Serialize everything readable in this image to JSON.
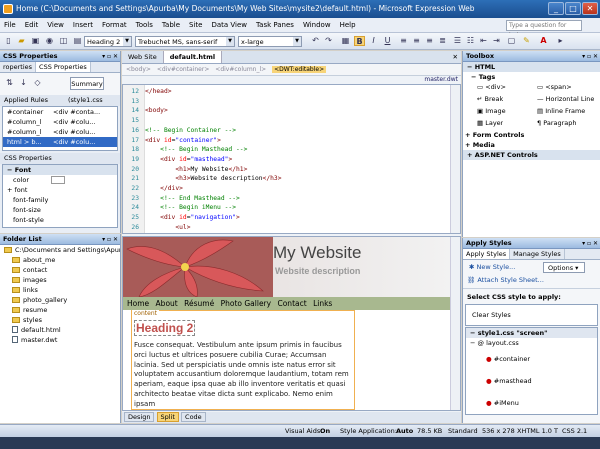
{
  "window": {
    "title": "Home (C:\\Documents and Settings\\Apurba\\My Documents\\My Web Sites\\mysite2\\default.html) - Microsoft Expression Web",
    "min": "_",
    "max": "□",
    "close": "✕"
  },
  "menu": [
    "File",
    "Edit",
    "View",
    "Insert",
    "Format",
    "Tools",
    "Table",
    "Site",
    "Data View",
    "Task Panes",
    "Window",
    "Help"
  ],
  "help_search": {
    "placeholder": "Type a question for help"
  },
  "toolbar": {
    "style": "Heading 2",
    "font": "Trebuchet MS, sans-serif",
    "size": "x-large",
    "bold": "B",
    "italic": "I",
    "underline": "U"
  },
  "css_properties_panel": {
    "title": "CSS Properties",
    "tabs": [
      "roperties",
      "CSS Properties"
    ],
    "summary_button": "Summary",
    "applied_rules_label": "Applied Rules",
    "applied_rules_source": "(style1.css",
    "rules": [
      [
        "#container",
        "<div #conta..."
      ],
      [
        "#column_l",
        "<div #colu..."
      ],
      [
        "#column_l",
        "<div #colu..."
      ],
      [
        "html > b...",
        "<div #colu..."
      ]
    ],
    "props_header": "CSS Properties",
    "font_group": "Font",
    "props": [
      "color",
      "font",
      "font-family",
      "font-size",
      "font-style"
    ]
  },
  "folder_list": {
    "title": "Folder List",
    "root": "C:\\Documents and Settings\\Apurba",
    "items": [
      {
        "name": "about_me",
        "type": "folder"
      },
      {
        "name": "contact",
        "type": "folder"
      },
      {
        "name": "images",
        "type": "folder"
      },
      {
        "name": "links",
        "type": "folder"
      },
      {
        "name": "photo_gallery",
        "type": "folder"
      },
      {
        "name": "resume",
        "type": "folder"
      },
      {
        "name": "styles",
        "type": "folder"
      },
      {
        "name": "default.html",
        "type": "file"
      },
      {
        "name": "master.dwt",
        "type": "file"
      }
    ]
  },
  "editor": {
    "tabs": [
      "Web Site",
      "default.html"
    ],
    "breadcrumb": [
      "<body>",
      "<div#container>",
      "<div#column_l>",
      "<DWT:editable>"
    ],
    "master_link": "master.dwt",
    "code_lines": [
      {
        "n": "12",
        "text": "</head>"
      },
      {
        "n": "13",
        "text": ""
      },
      {
        "n": "14",
        "text": "<body>"
      },
      {
        "n": "15",
        "text": ""
      },
      {
        "n": "16",
        "text": "<!-- Begin Container -->"
      },
      {
        "n": "17",
        "text": "<div id=\"container\">"
      },
      {
        "n": "18",
        "text": "    <!-- Begin Masthead -->"
      },
      {
        "n": "19",
        "text": "    <div id=\"masthead\">"
      },
      {
        "n": "20",
        "text": "        <h1>My Website</h1>"
      },
      {
        "n": "21",
        "text": "        <h3>Website description</h3>"
      },
      {
        "n": "22",
        "text": "    </div>"
      },
      {
        "n": "23",
        "text": "    <!-- End Masthead -->"
      },
      {
        "n": "24",
        "text": "    <!-- Begin iMenu -->"
      },
      {
        "n": "25",
        "text": "    <div id=\"navigation\">"
      },
      {
        "n": "26",
        "text": "        <ul>"
      }
    ],
    "design": {
      "site_title": "My Website",
      "site_desc": "Website description",
      "nav": [
        "Home",
        "About",
        "Résumé",
        "Photo Gallery",
        "Contact",
        "Links"
      ],
      "content_label": "content",
      "heading": "Heading 2",
      "paragraph": "Fusce consequat. Vestibulum ante ipsum primis in faucibus orci luctus et ultrices posuere cubilia Curae; Accumsan lacinia. Sed ut perspiciatis unde omnis iste natus error sit voluptatem accusantium doloremque laudantium, totam rem aperiam, eaque ipsa quae ab illo inventore veritatis et quasi architecto beatae vitae dicta sunt explicabo. Nemo enim ipsam"
    },
    "view_tabs": [
      "Design",
      "Split",
      "Code"
    ]
  },
  "toolbox": {
    "title": "Toolbox",
    "html_group": "HTML",
    "tags_group": "Tags",
    "tags": [
      [
        "<div>",
        "<span>"
      ],
      [
        "Break",
        "Horizontal Line"
      ],
      [
        "Image",
        "Inline Frame"
      ],
      [
        "Layer",
        "Paragraph"
      ]
    ],
    "form_controls": "Form Controls",
    "media": "Media",
    "aspnet_controls": "ASP.NET Controls"
  },
  "apply_styles": {
    "title": "Apply Styles",
    "tabs": [
      "Apply Styles",
      "Manage Styles"
    ],
    "new_style": "New Style...",
    "options": "Options",
    "attach": "Attach Style Sheet...",
    "select_label": "Select CSS style to apply:",
    "clear": "Clear Styles",
    "sheet": "style1.css \"screen\"",
    "layout": "@ layout.css",
    "styles": [
      "#container",
      "#masthead",
      "#iMenu"
    ]
  },
  "status": {
    "visual_aids": "Visual Aids:",
    "visual_aids_val": "On",
    "style_app": "Style Application:",
    "style_app_val": "Auto",
    "size": "78.5 KB",
    "mode": "Standard",
    "dims": "536 x 278",
    "doctype": "XHTML 1.0 T",
    "css": "CSS 2.1"
  },
  "colors": {
    "accent": "#2d6fb7",
    "heading": "#c0504d",
    "nav_bg": "#a8b88f"
  }
}
